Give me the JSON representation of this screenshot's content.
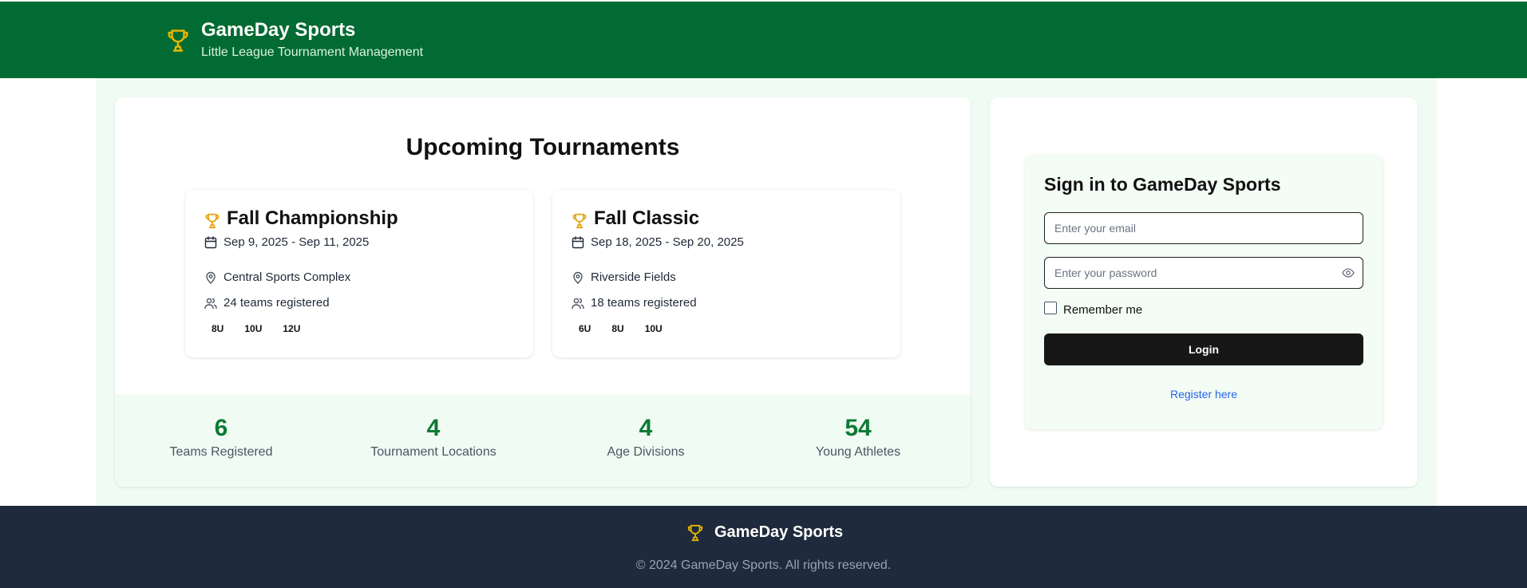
{
  "colors": {
    "header_bg": "#026b33",
    "accent_gold": "#e6a800",
    "stat_green": "#0d7a35",
    "footer_bg": "#1f2a3c",
    "link_blue": "#2563eb",
    "button_bg": "#171717"
  },
  "header": {
    "title": "GameDay Sports",
    "subtitle": "Little League Tournament Management",
    "icon": "trophy-icon"
  },
  "tournaments": {
    "heading": "Upcoming Tournaments",
    "items": [
      {
        "name": "Fall Championship",
        "dates": "Sep 9, 2025 - Sep 11, 2025",
        "location": "Central Sports Complex",
        "teams": "24 teams registered",
        "divisions": [
          "8U",
          "10U",
          "12U"
        ]
      },
      {
        "name": "Fall Classic",
        "dates": "Sep 18, 2025 - Sep 20, 2025",
        "location": "Riverside Fields",
        "teams": "18 teams registered",
        "divisions": [
          "6U",
          "8U",
          "10U"
        ]
      }
    ]
  },
  "stats": [
    {
      "value": "6",
      "label": "Teams Registered"
    },
    {
      "value": "4",
      "label": "Tournament Locations"
    },
    {
      "value": "4",
      "label": "Age Divisions"
    },
    {
      "value": "54",
      "label": "Young Athletes"
    }
  ],
  "login": {
    "title": "Sign in to GameDay Sports",
    "email_placeholder": "Enter your email",
    "password_placeholder": "Enter your password",
    "remember_label": "Remember me",
    "remember_checked": false,
    "button_label": "Login",
    "register_link": "Register here"
  },
  "footer": {
    "brand": "GameDay Sports",
    "copyright": "© 2024 GameDay Sports. All rights reserved."
  }
}
